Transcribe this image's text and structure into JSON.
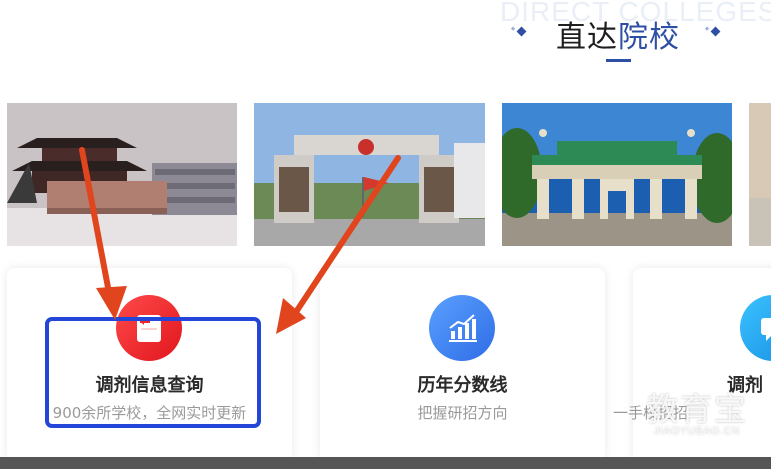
{
  "section": {
    "bg_title": "DIRECT COLLEGES",
    "title_main": "直达",
    "title_accent": "院校"
  },
  "photos": [
    {
      "label": "校园大门照片1"
    },
    {
      "label": "校园大门照片2"
    },
    {
      "label": "校园牌坊照片3"
    }
  ],
  "cards": [
    {
      "title": "调剂信息查询",
      "subtitle": "900余所学校，全网实时更新",
      "icon": "document-icon",
      "color": "#f0242a"
    },
    {
      "title": "历年分数线",
      "subtitle": "把握研招方向",
      "icon": "bar-chart-icon",
      "color": "#3a7ef0"
    },
    {
      "title": "调剂",
      "subtitle": "一手校招招",
      "icon": "chat-icon",
      "color": "#27a0ee"
    }
  ],
  "watermark": {
    "main": "教育宝",
    "url": "JIAOYUBAO.CN"
  },
  "colors": {
    "accent": "#2e4fa3",
    "annotation_box": "#2346d8",
    "arrow": "#e0451d"
  }
}
